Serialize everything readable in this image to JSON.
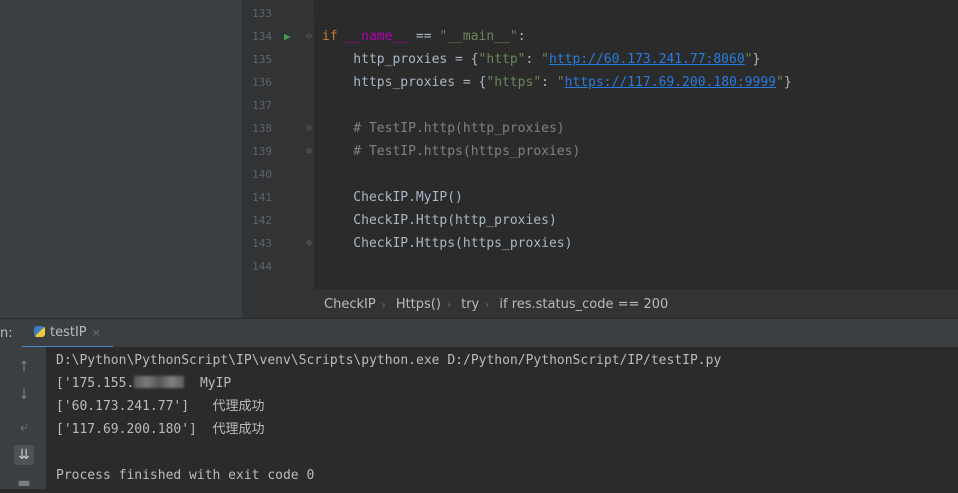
{
  "editor": {
    "lines": [
      {
        "num": "133",
        "segments": []
      },
      {
        "num": "134",
        "run": true,
        "fold": "⊖",
        "segments": [
          {
            "t": "if ",
            "c": "kw"
          },
          {
            "t": "__name__",
            "c": "dunder"
          },
          {
            "t": " == ",
            "c": ""
          },
          {
            "t": "\"__main__\"",
            "c": "str"
          },
          {
            "t": ":",
            "c": ""
          }
        ]
      },
      {
        "num": "135",
        "segments": [
          {
            "t": "    http_proxies = {",
            "c": ""
          },
          {
            "t": "\"http\"",
            "c": "str"
          },
          {
            "t": ": ",
            "c": ""
          },
          {
            "t": "\"",
            "c": "str"
          },
          {
            "t": "http://60.173.241.77:8060",
            "c": "url"
          },
          {
            "t": "\"",
            "c": "str"
          },
          {
            "t": "}",
            "c": ""
          }
        ]
      },
      {
        "num": "136",
        "segments": [
          {
            "t": "    https_proxies = {",
            "c": ""
          },
          {
            "t": "\"https\"",
            "c": "str"
          },
          {
            "t": ": ",
            "c": ""
          },
          {
            "t": "\"",
            "c": "str"
          },
          {
            "t": "https://117.69.200.180:9999",
            "c": "url"
          },
          {
            "t": "\"",
            "c": "str"
          },
          {
            "t": "}",
            "c": ""
          }
        ]
      },
      {
        "num": "137",
        "segments": []
      },
      {
        "num": "138",
        "fold": "⊖",
        "segments": [
          {
            "t": "    # TestIP.http(http_proxies)",
            "c": "cmt"
          }
        ]
      },
      {
        "num": "139",
        "fold": "⊕",
        "segments": [
          {
            "t": "    # TestIP.https(https_proxies)",
            "c": "cmt"
          }
        ]
      },
      {
        "num": "140",
        "segments": []
      },
      {
        "num": "141",
        "segments": [
          {
            "t": "    CheckIP.MyIP()",
            "c": ""
          }
        ]
      },
      {
        "num": "142",
        "segments": [
          {
            "t": "    CheckIP.Http(http_proxies)",
            "c": ""
          }
        ]
      },
      {
        "num": "143",
        "fold": "⊕",
        "segments": [
          {
            "t": "    CheckIP.Https(https_proxies)",
            "c": ""
          }
        ]
      },
      {
        "num": "144",
        "segments": []
      }
    ]
  },
  "breadcrumb": [
    "CheckIP",
    "Https()",
    "try",
    "if res.status_code == 200"
  ],
  "run_panel": {
    "label": "n:",
    "tab_label": "testIP",
    "tab_close": "×",
    "toolbar_icons": [
      "up-arrow-icon",
      "down-arrow-icon",
      "soft-wrap-icon",
      "scroll-to-end-icon",
      "print-icon"
    ]
  },
  "console": {
    "command": "D:\\Python\\PythonScript\\IP\\venv\\Scripts\\python.exe D:/Python/PythonScript/IP/testIP.py",
    "out1_prefix": "['175.155.",
    "out1_suffix": "MyIP",
    "out2": "['60.173.241.77']   ",
    "out2_msg": "代理成功",
    "out3": "['117.69.200.180']  ",
    "out3_msg": "代理成功",
    "exit": "Process finished with exit code 0"
  },
  "colors": {
    "keyword": "#cc7832",
    "string": "#6a8759",
    "url": "#287bde",
    "comment": "#808080",
    "dunder": "#b200b2"
  }
}
